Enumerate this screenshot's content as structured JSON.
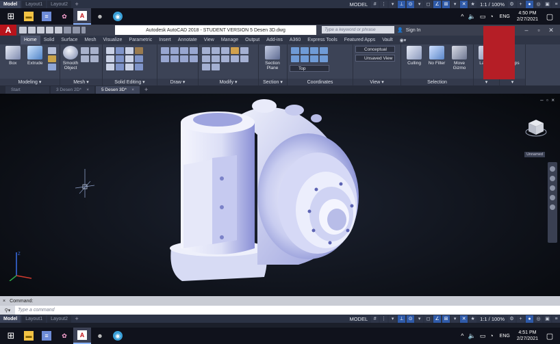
{
  "layout_tabs": [
    "Model",
    "Layout1",
    "Layout2"
  ],
  "status_bar": {
    "model_label": "MODEL",
    "scale": "1:1 / 100%"
  },
  "taskbar": {
    "time_top": "4:50 PM",
    "date_top": "2/27/2021",
    "time_bottom": "4:51 PM",
    "date_bottom": "2/27/2021",
    "lang": "ENG"
  },
  "titlebar": {
    "app_letter": "A",
    "title": "Autodesk AutoCAD 2018 - STUDENT VERSION    5 Desen 3D.dwg",
    "search_placeholder": "Type a keyword or phrase",
    "signin": "Sign In"
  },
  "ribbon_tabs": [
    "Home",
    "Solid",
    "Surface",
    "Mesh",
    "Visualize",
    "Parametric",
    "Insert",
    "Annotate",
    "View",
    "Manage",
    "Output",
    "Add-ins",
    "A360",
    "Express Tools",
    "Featured Apps",
    "Vault"
  ],
  "ribbon": {
    "box": "Box",
    "extrude": "Extrude",
    "smooth_object": "Smooth Object",
    "section_plane": "Section Plane",
    "culling": "Culling",
    "no_filter": "No Filter",
    "move_gizmo": "Move Gizmo",
    "layers": "Layers",
    "groups": "Groups",
    "visual_style": "Conceptual",
    "unsaved_view": "Unsaved View",
    "top_view": "Top",
    "panels": [
      "Modeling",
      "Mesh",
      "Solid Editing",
      "Draw",
      "Modify",
      "Section",
      "Coordinates",
      "View",
      "Selection"
    ]
  },
  "file_tabs": [
    "Start",
    "3 Desen 2D*",
    "5 Desen 3D*"
  ],
  "viewport": {
    "viewcube_label": "Unnamed"
  },
  "command": {
    "history": "Command:",
    "placeholder": "Type a command"
  },
  "colors": {
    "accent": "#2f5aa8",
    "app_red": "#b8141b",
    "model_fill": "#e9ebf8",
    "model_shade": "#8a90d6"
  }
}
